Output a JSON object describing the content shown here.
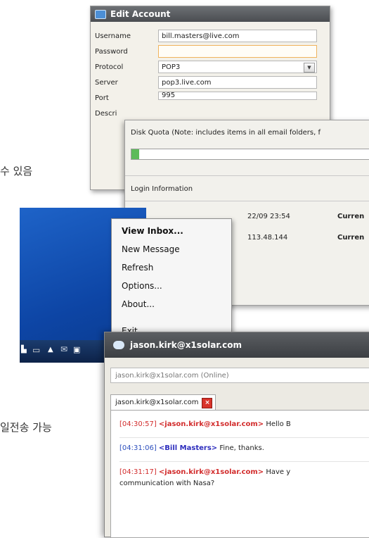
{
  "captions": {
    "top": "수 있음",
    "bottom": "일전송 가능"
  },
  "edit_account": {
    "title": "Edit Account",
    "fields": [
      {
        "label": "Username",
        "value": "bill.masters@live.com"
      },
      {
        "label": "Password",
        "value": ""
      },
      {
        "label": "Protocol",
        "value": "POP3"
      },
      {
        "label": "Server",
        "value": "pop3.live.com"
      },
      {
        "label": "Port",
        "value": "995"
      },
      {
        "label": "Descri",
        "value": ""
      }
    ]
  },
  "quota_panel": {
    "disk_quota_label": "Disk Quota (Note: includes items in all email folders, f",
    "quota_used_fraction": 0.03,
    "login_info_label": "Login Information",
    "login_rows": [
      {
        "time": "22/09 23:54",
        "status": "Curren"
      },
      {
        "time": "113.48.144",
        "status": "Curren"
      }
    ]
  },
  "context_menu": {
    "items": [
      "View Inbox...",
      "New Message",
      "Refresh",
      "Options...",
      "About...",
      "Exit"
    ]
  },
  "chat": {
    "title": "jason.kirk@x1solar.com",
    "status": "jason.kirk@x1solar.com (Online)",
    "tab_label": "jason.kirk@x1solar.com",
    "tab_close": "x",
    "messages": [
      {
        "time": "[04:30:57]",
        "nick": "<jason.kirk@x1solar.com>",
        "text": "Hello B",
        "cont": ""
      },
      {
        "time": "[04:31:06]",
        "nick": "<Bill Masters>",
        "text": "Fine, thanks.",
        "cont": ""
      },
      {
        "time": "[04:31:17]",
        "nick": "<jason.kirk@x1solar.com>",
        "text": "Have y",
        "cont": "communication with Nasa?"
      }
    ]
  },
  "colors": {
    "quota_fill": "#5dbb5a",
    "desktop_blue": "#0d45a5"
  }
}
